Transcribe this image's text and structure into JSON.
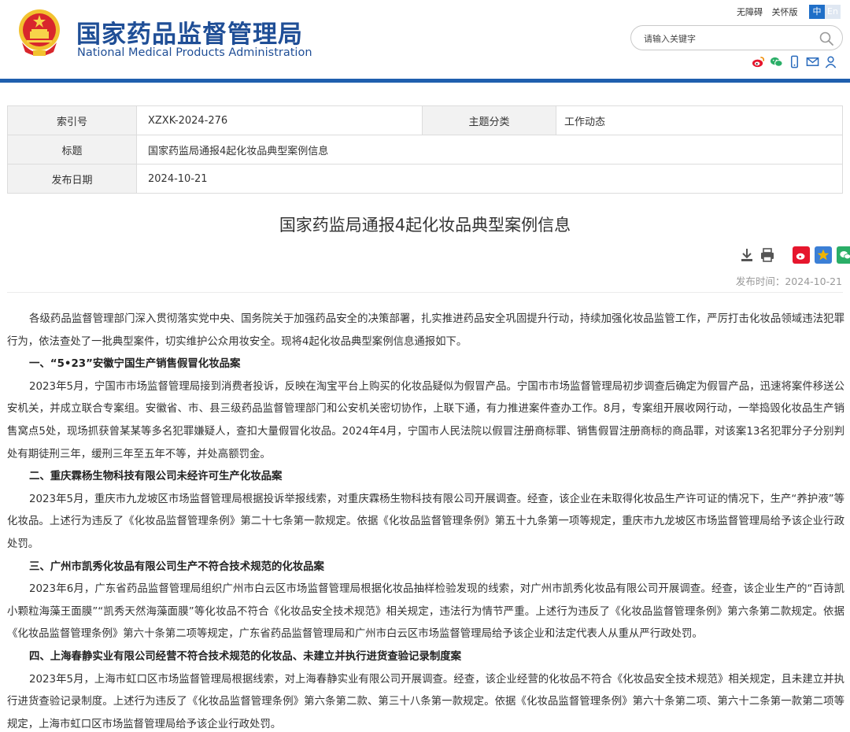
{
  "header": {
    "site_title": "国家药品监督管理局",
    "site_subtitle": "National Medical Products Administration",
    "top_links": [
      "无障碍",
      "关怀版"
    ],
    "lang_zh": "中",
    "lang_en": "En",
    "search_placeholder": "请输入关键字",
    "social_icons": [
      "weibo-icon",
      "wechat-icon",
      "mobile-icon",
      "mail-icon",
      "user-icon"
    ]
  },
  "meta": {
    "index_label": "索引号",
    "index_value": "XZXK-2024-276",
    "category_label": "主题分类",
    "category_value": "工作动态",
    "title_label": "标题",
    "title_value": "国家药监局通报4起化妆品典型案例信息",
    "date_label": "发布日期",
    "date_value": "2024-10-21"
  },
  "article": {
    "title": "国家药监局通报4起化妆品典型案例信息",
    "publish_time": "发布时间：2024-10-21",
    "paragraphs": [
      {
        "type": "p",
        "text": "各级药品监督管理部门深入贯彻落实党中央、国务院关于加强药品安全的决策部署，扎实推进药品安全巩固提升行动，持续加强化妆品监管工作，严厉打击化妆品领域违法犯罪行为，依法查处了一批典型案件，切实维护公众用妆安全。现将4起化妆品典型案例信息通报如下。"
      },
      {
        "type": "h",
        "text": "一、“5•23”安徽宁国生产销售假冒化妆品案"
      },
      {
        "type": "p",
        "text": "2023年5月，宁国市市场监督管理局接到消费者投诉，反映在淘宝平台上购买的化妆品疑似为假冒产品。宁国市市场监督管理局初步调查后确定为假冒产品，迅速将案件移送公安机关，并成立联合专案组。安徽省、市、县三级药品监督管理部门和公安机关密切协作，上联下通，有力推进案件查办工作。8月，专案组开展收网行动，一举捣毁化妆品生产销售窝点5处，现场抓获曾某某等多名犯罪嫌疑人，查扣大量假冒化妆品。2024年4月，宁国市人民法院以假冒注册商标罪、销售假冒注册商标的商品罪，对该案13名犯罪分子分别判处有期徒刑三年，缓刑三年至五年不等，并处高额罚金。"
      },
      {
        "type": "h",
        "text": "二、重庆霖杨生物科技有限公司未经许可生产化妆品案"
      },
      {
        "type": "p",
        "text": "2023年5月，重庆市九龙坡区市场监督管理局根据投诉举报线索，对重庆霖杨生物科技有限公司开展调查。经查，该企业在未取得化妆品生产许可证的情况下，生产“养护液”等化妆品。上述行为违反了《化妆品监督管理条例》第二十七条第一款规定。依据《化妆品监督管理条例》第五十九条第一项等规定，重庆市九龙坡区市场监督管理局给予该企业行政处罚。"
      },
      {
        "type": "h",
        "text": "三、广州市凯秀化妆品有限公司生产不符合技术规范的化妆品案"
      },
      {
        "type": "p",
        "text": "2023年6月，广东省药品监督管理局组织广州市白云区市场监督管理局根据化妆品抽样检验发现的线索，对广州市凯秀化妆品有限公司开展调查。经查，该企业生产的“百诗凯小颗粒海藻王面膜”“凯秀天然海藻面膜”等化妆品不符合《化妆品安全技术规范》相关规定，违法行为情节严重。上述行为违反了《化妆品监督管理条例》第六条第二款规定。依据《化妆品监督管理条例》第六十条第二项等规定，广东省药品监督管理局和广州市白云区市场监督管理局给予该企业和法定代表人从重从严行政处罚。"
      },
      {
        "type": "h",
        "text": "四、上海春静实业有限公司经营不符合技术规范的化妆品、未建立并执行进货查验记录制度案"
      },
      {
        "type": "p",
        "text": "2023年5月，上海市虹口区市场监督管理局根据线索，对上海春静实业有限公司开展调查。经查，该企业经营的化妆品不符合《化妆品安全技术规范》相关规定，且未建立并执行进货查验记录制度。上述行为违反了《化妆品监督管理条例》第六条第二款、第三十八条第一款规定。依据《化妆品监督管理条例》第六十条第二项、第六十二条第一款第二项等规定，上海市虹口区市场监督管理局给予该企业行政处罚。"
      }
    ]
  },
  "colors": {
    "brand_blue": "#1f4e96",
    "header_line": "#1f5fae",
    "weibo": "#e6162d",
    "wechat": "#2aae67",
    "favorite": "#f0b400"
  }
}
